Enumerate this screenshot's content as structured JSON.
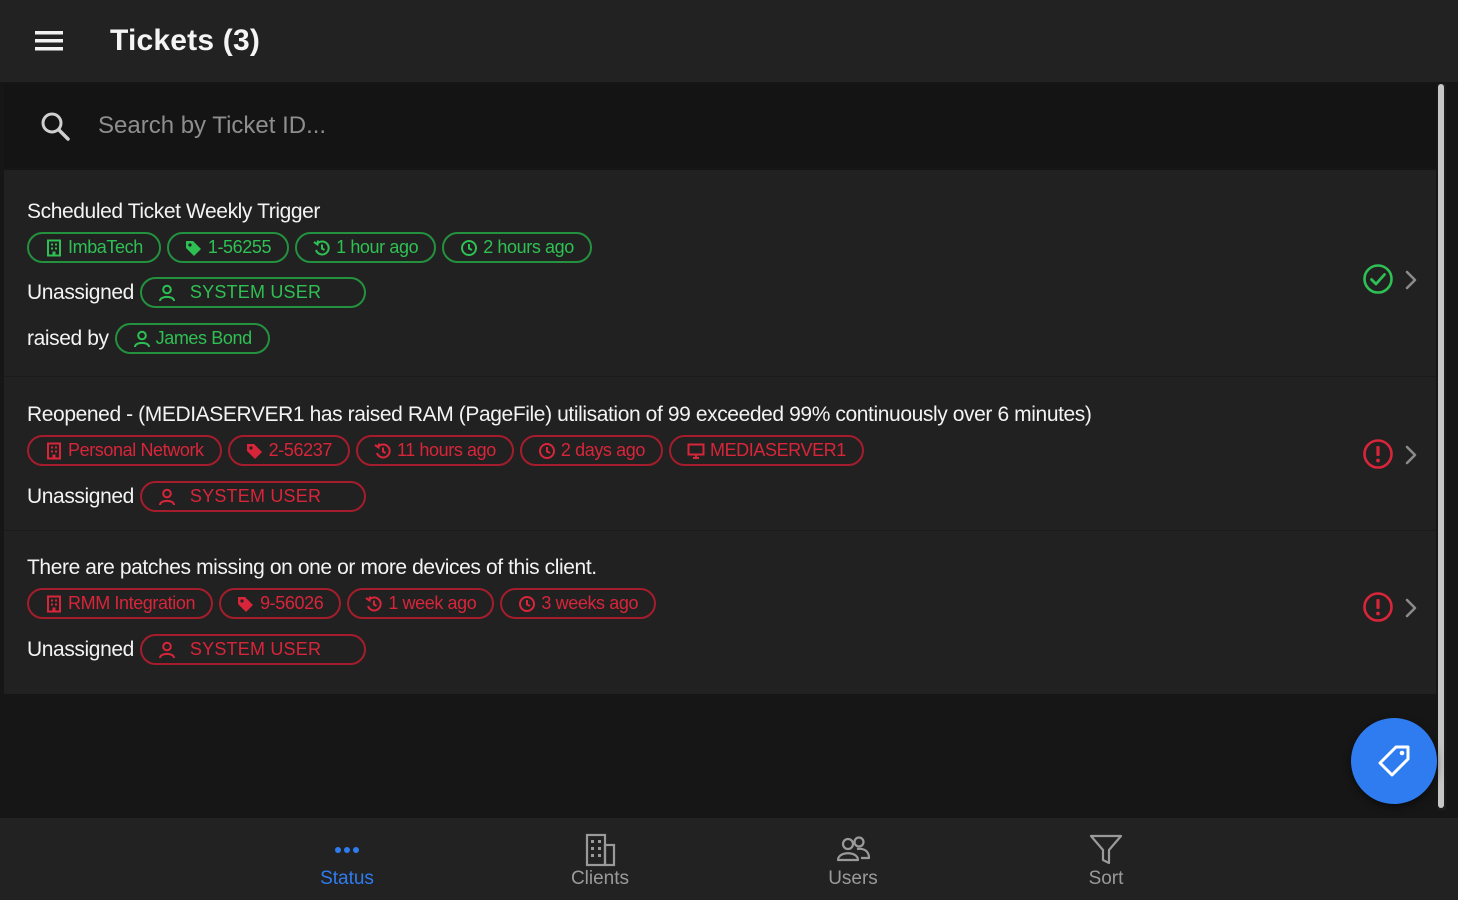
{
  "header": {
    "title": "Tickets (3)",
    "menu_icon": "hamburger-menu-icon"
  },
  "search": {
    "placeholder": "Search by Ticket ID..."
  },
  "colors": {
    "green": "#2fc054",
    "red": "#d8253a",
    "accent": "#2f7cf0",
    "background": "#161616",
    "card": "#212121"
  },
  "tickets": [
    {
      "title": "Scheduled Ticket Weekly Trigger",
      "status": "resolved",
      "client": "ImbaTech",
      "ticket_id": "1-56255",
      "updated": "1 hour ago",
      "created": "2 hours ago",
      "assigned_label": "Unassigned",
      "assigned_user": "SYSTEM USER",
      "raised_label": "raised by",
      "raised_by": "James Bond"
    },
    {
      "title": "Reopened - (MEDIASERVER1 has raised RAM (PageFile) utilisation of 99 exceeded 99% continuously over 6 minutes)",
      "status": "alert",
      "client": "Personal Network",
      "ticket_id": "2-56237",
      "updated": "11 hours ago",
      "created": "2 days ago",
      "device": "MEDIASERVER1",
      "assigned_label": "Unassigned",
      "assigned_user": "SYSTEM USER"
    },
    {
      "title": "There are patches missing on one or more devices of this client.",
      "status": "alert",
      "client": "RMM Integration",
      "ticket_id": "9-56026",
      "updated": "1 week ago",
      "created": "3 weeks ago",
      "assigned_label": "Unassigned",
      "assigned_user": "SYSTEM USER"
    }
  ],
  "fab": {
    "icon": "tag-icon"
  },
  "bottom_nav": {
    "items": [
      {
        "label": "Status",
        "icon": "dots-icon",
        "active": true
      },
      {
        "label": "Clients",
        "icon": "building-icon",
        "active": false
      },
      {
        "label": "Users",
        "icon": "users-icon",
        "active": false
      },
      {
        "label": "Sort",
        "icon": "filter-icon",
        "active": false
      }
    ]
  }
}
